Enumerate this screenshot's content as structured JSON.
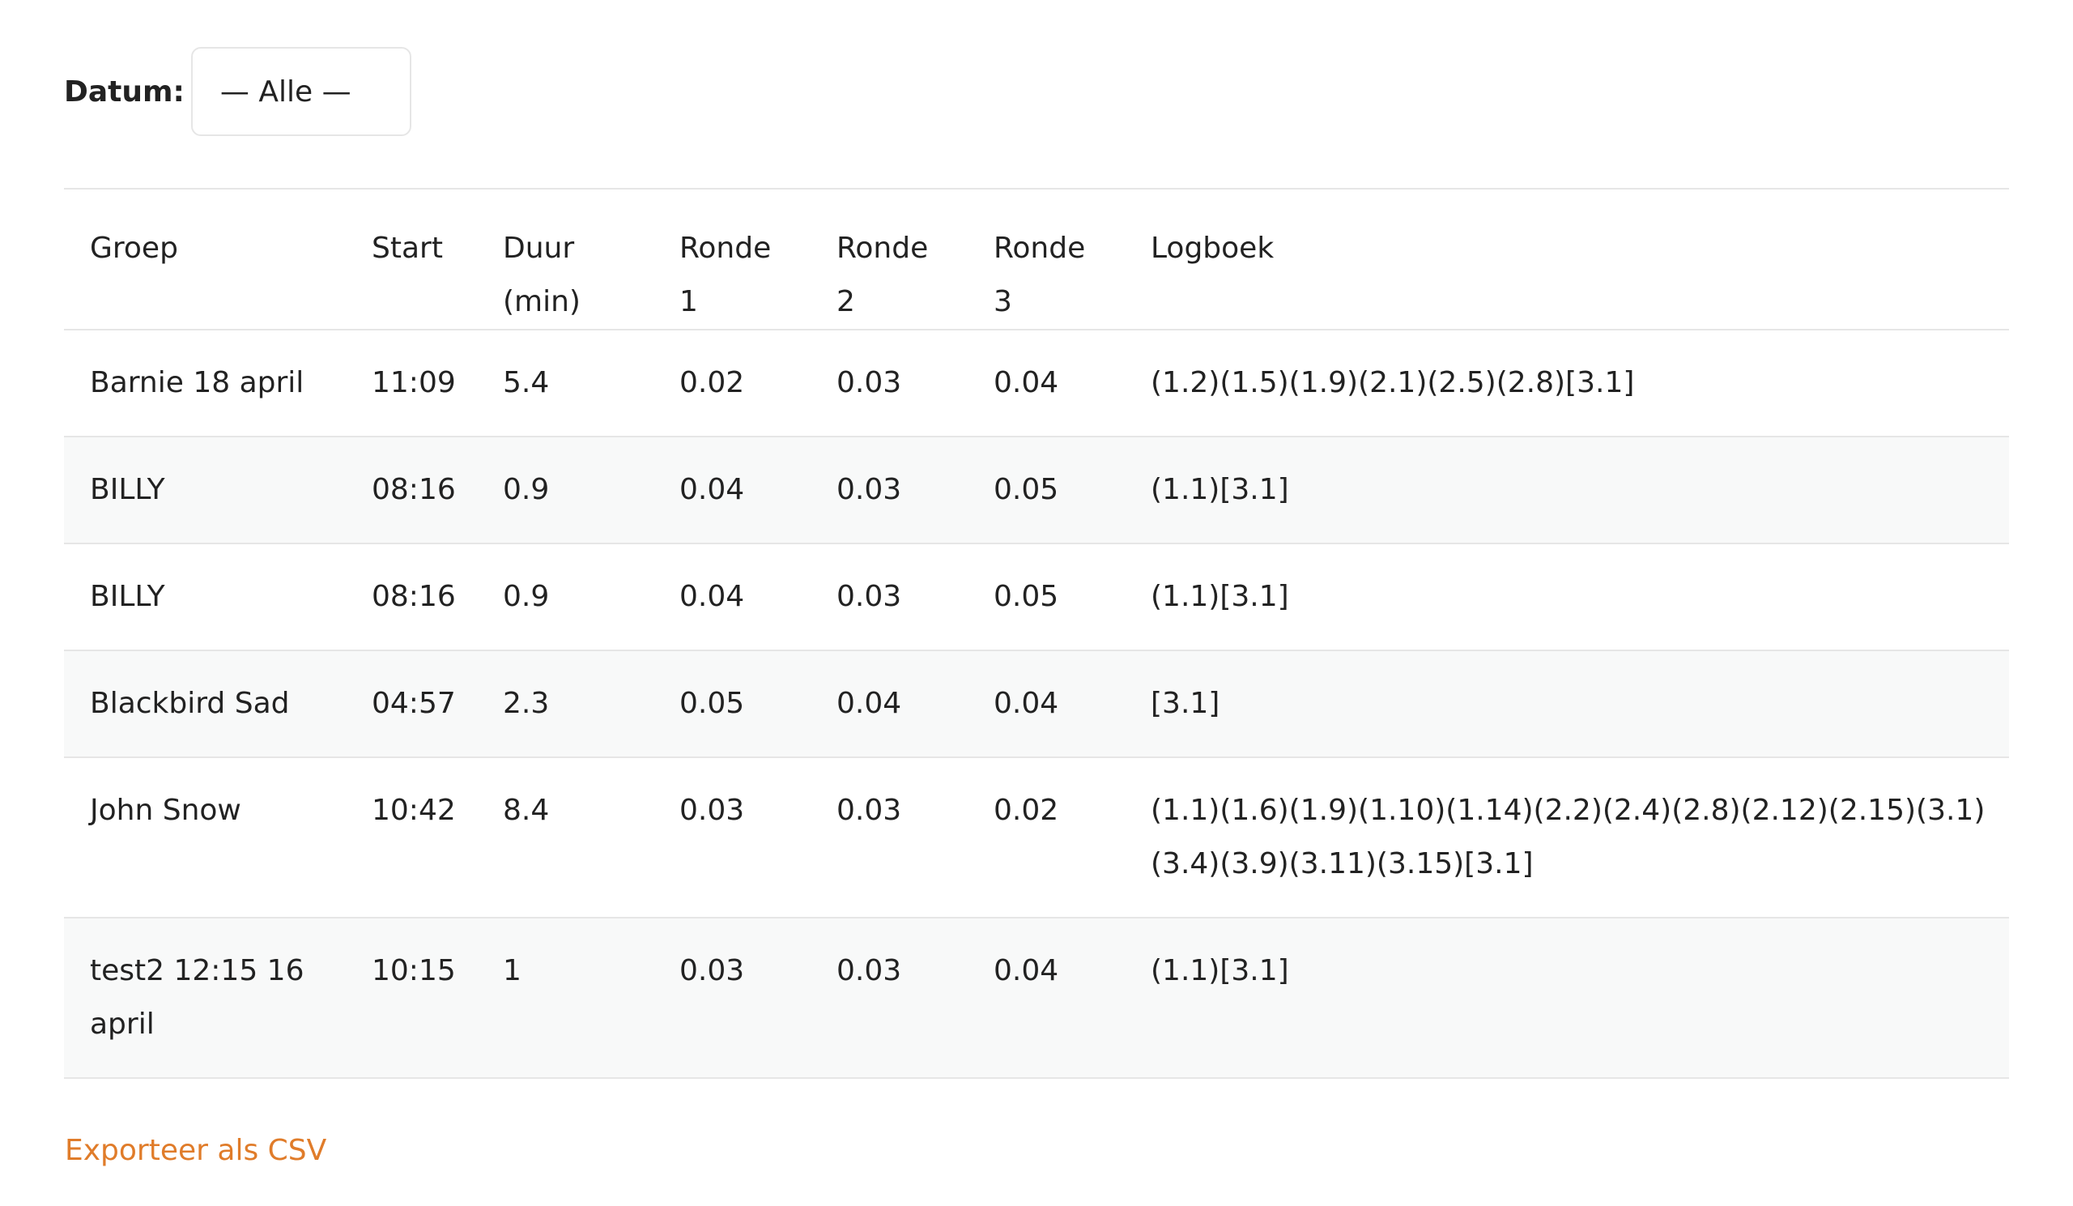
{
  "filter": {
    "label": "Datum:",
    "selected": "— Alle —"
  },
  "table": {
    "headers": [
      "Groep",
      "Start",
      "Duur (min)",
      "Ronde 1",
      "Ronde 2",
      "Ronde 3",
      "Logboek"
    ],
    "rows": [
      [
        "Barnie 18 april",
        "11:09",
        "5.4",
        "0.02",
        "0.03",
        "0.04",
        "(1.2)(1.5)(1.9)(2.1)(2.5)(2.8)[3.1]"
      ],
      [
        "BILLY",
        "08:16",
        "0.9",
        "0.04",
        "0.03",
        "0.05",
        "(1.1)[3.1]"
      ],
      [
        "BILLY",
        "08:16",
        "0.9",
        "0.04",
        "0.03",
        "0.05",
        "(1.1)[3.1]"
      ],
      [
        "Blackbird Sad",
        "04:57",
        "2.3",
        "0.05",
        "0.04",
        "0.04",
        "[3.1]"
      ],
      [
        "John Snow",
        "10:42",
        "8.4",
        "0.03",
        "0.03",
        "0.02",
        "(1.1)(1.6)(1.9)(1.10)(1.14)(2.2)(2.4)(2.8)(2.12)(2.15)(3.1)(3.4)(3.9)(3.11)(3.15)[3.1]"
      ],
      [
        "test2 12:15 16 april",
        "10:15",
        "1",
        "0.03",
        "0.03",
        "0.04",
        "(1.1)[3.1]"
      ]
    ]
  },
  "export": {
    "label": "Exporteer als CSV"
  },
  "colors": {
    "link": "#e07c2a",
    "border": "#e6e6e6",
    "stripe": "#f8f9f9"
  }
}
